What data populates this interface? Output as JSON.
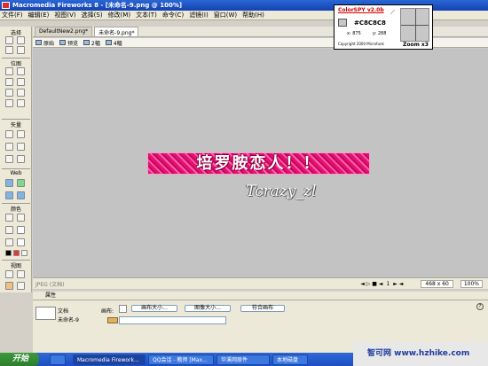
{
  "window": {
    "title": "Macromedia Fireworks 8 - [未命名-9.png @ 100%]"
  },
  "menu": [
    "文件(F)",
    "编辑(E)",
    "视图(V)",
    "选择(S)",
    "修改(M)",
    "文本(T)",
    "命令(C)",
    "滤镜(I)",
    "窗口(W)",
    "帮助(H)"
  ],
  "toolbox": {
    "sections": [
      "选择",
      "位图",
      "矢量",
      "Web",
      "颜色",
      "视图"
    ]
  },
  "tabs": [
    {
      "label": "DefaultNew2.png*"
    },
    {
      "label": "未命名-9.png*"
    }
  ],
  "viewbar": {
    "original": "原始",
    "preview": "预览",
    "two_up": "2幅",
    "four_up": "4幅"
  },
  "canvas": {
    "banner_text": "培罗胺恋人！！",
    "signature": "Tcrazy_zl",
    "banner_color": "#e5116e"
  },
  "statusbar": {
    "format": "JPEG (文档)",
    "frame": "1",
    "size": "468 x 60",
    "zoom": "100%"
  },
  "properties": {
    "panel_title": "属性",
    "doc_label": "文档",
    "doc_name": "未命名-9",
    "canvas_label": "画布:",
    "btn_canvas_size": "画布大小...",
    "btn_image_size": "图像大小...",
    "btn_fit_canvas": "符合画布"
  },
  "colorspy": {
    "title": "ColorSPY v2.0b",
    "hex": "#C8C8C8",
    "x": "x: 875",
    "y": "y: 288",
    "copyright": "Copyright 2000 Microfunk",
    "zoom": "Zoom x3"
  },
  "taskbar": {
    "start": "开始",
    "tasks": [
      "Macromedia Firework...",
      "QQ会话 - 教师 [Max...",
      "华溪网原件",
      "本地磁盘"
    ]
  },
  "watermark": "智可网 www.hzhike.com"
}
